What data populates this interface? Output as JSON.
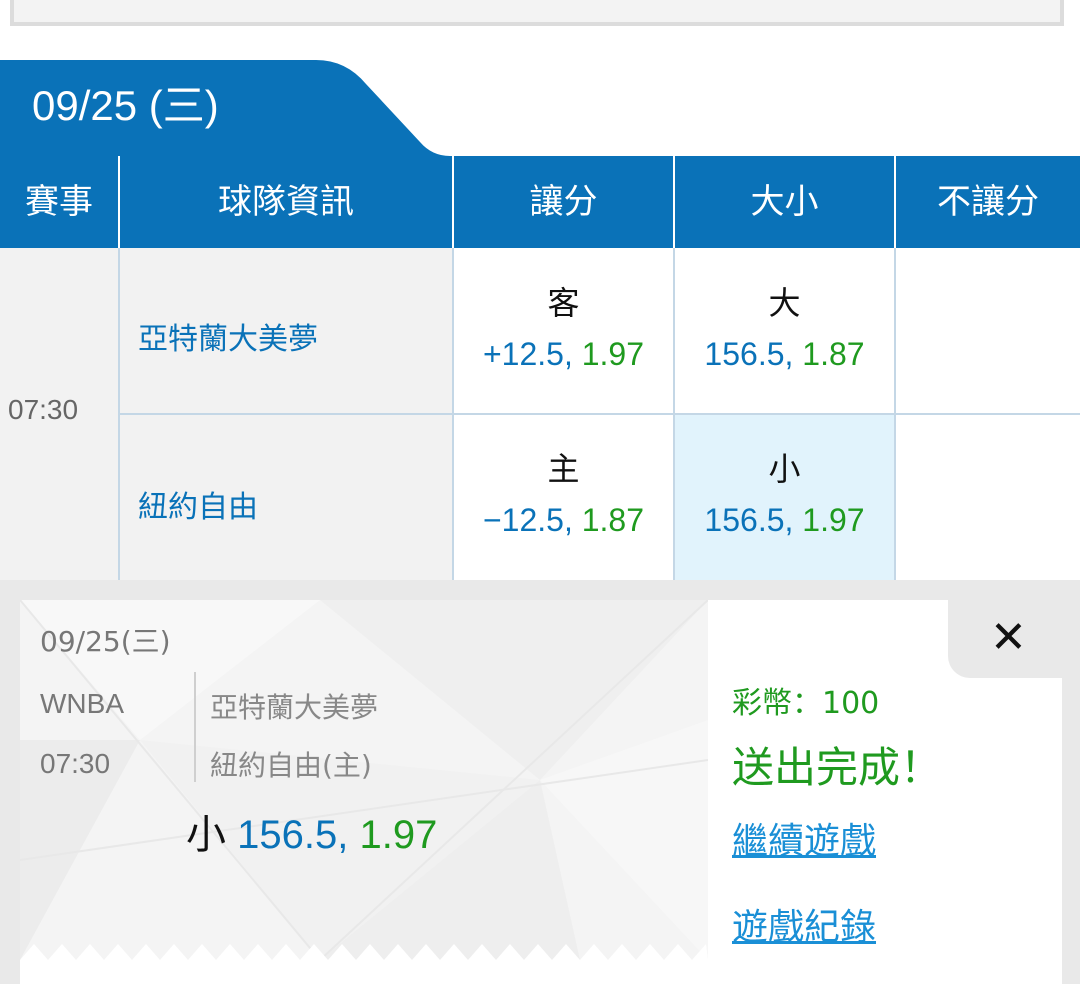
{
  "date_tab": "09/25 (三)",
  "header": {
    "col_match": "賽事",
    "col_team_info": "球隊資訊",
    "col_spread": "讓分",
    "col_total": "大小",
    "col_moneyline": "不讓分"
  },
  "game": {
    "time": "07:30",
    "away": {
      "name": "亞特蘭大美夢",
      "spread_label": "客",
      "spread_line": "+12.5,",
      "spread_odds": "1.97",
      "total_label": "大",
      "total_line": "156.5,",
      "total_odds": "1.87"
    },
    "home": {
      "name": "紐約自由",
      "spread_label": "主",
      "spread_line": "−12.5,",
      "spread_odds": "1.87",
      "total_label": "小",
      "total_line": "156.5,",
      "total_odds": "1.97"
    }
  },
  "slip": {
    "date": "09/25(三)",
    "league": "WNBA",
    "time": "07:30",
    "team1": "亞特蘭大美夢",
    "team2": "紐約自由(主)",
    "pick": "小",
    "line": "156.5,",
    "odds": "1.97",
    "coins": "彩幣：100",
    "status": "送出完成！",
    "continue_link": "繼續遊戲",
    "history_link": "遊戲紀錄",
    "close_glyph": "✕"
  },
  "colors": {
    "brand_blue": "#0a72b8",
    "odds_green": "#1f9a1f",
    "link_blue": "#1a8fd6",
    "selected_bg": "#e1f3fc"
  }
}
